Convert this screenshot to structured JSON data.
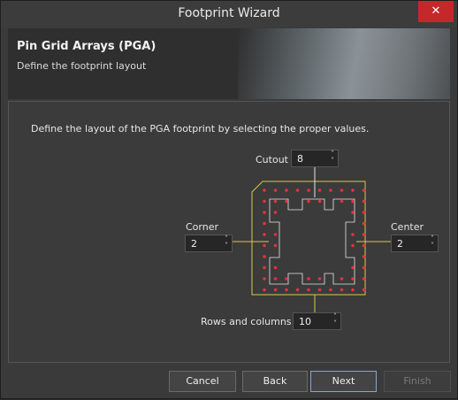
{
  "window": {
    "title": "Footprint Wizard",
    "close_label": "✕"
  },
  "banner": {
    "title": "Pin Grid Arrays (PGA)",
    "subtitle": "Define the footprint layout"
  },
  "instruction": "Define the layout of the PGA footprint by selecting the proper values.",
  "fields": {
    "cutout": {
      "label": "Cutout",
      "value": "8"
    },
    "corner": {
      "label": "Corner",
      "value": "2"
    },
    "center": {
      "label": "Center",
      "value": "2"
    },
    "rows_columns": {
      "label": "Rows and columns",
      "value": "10"
    }
  },
  "spin_arrows": {
    "up": "˄",
    "down": "˅"
  },
  "buttons": {
    "cancel": "Cancel",
    "back": "Back",
    "next": "Next",
    "finish": "Finish"
  },
  "colors": {
    "pin": "#e0343b",
    "outline": "#d8c84a",
    "cutout_line": "#e6e6e6",
    "close_bg": "#c4282b"
  }
}
